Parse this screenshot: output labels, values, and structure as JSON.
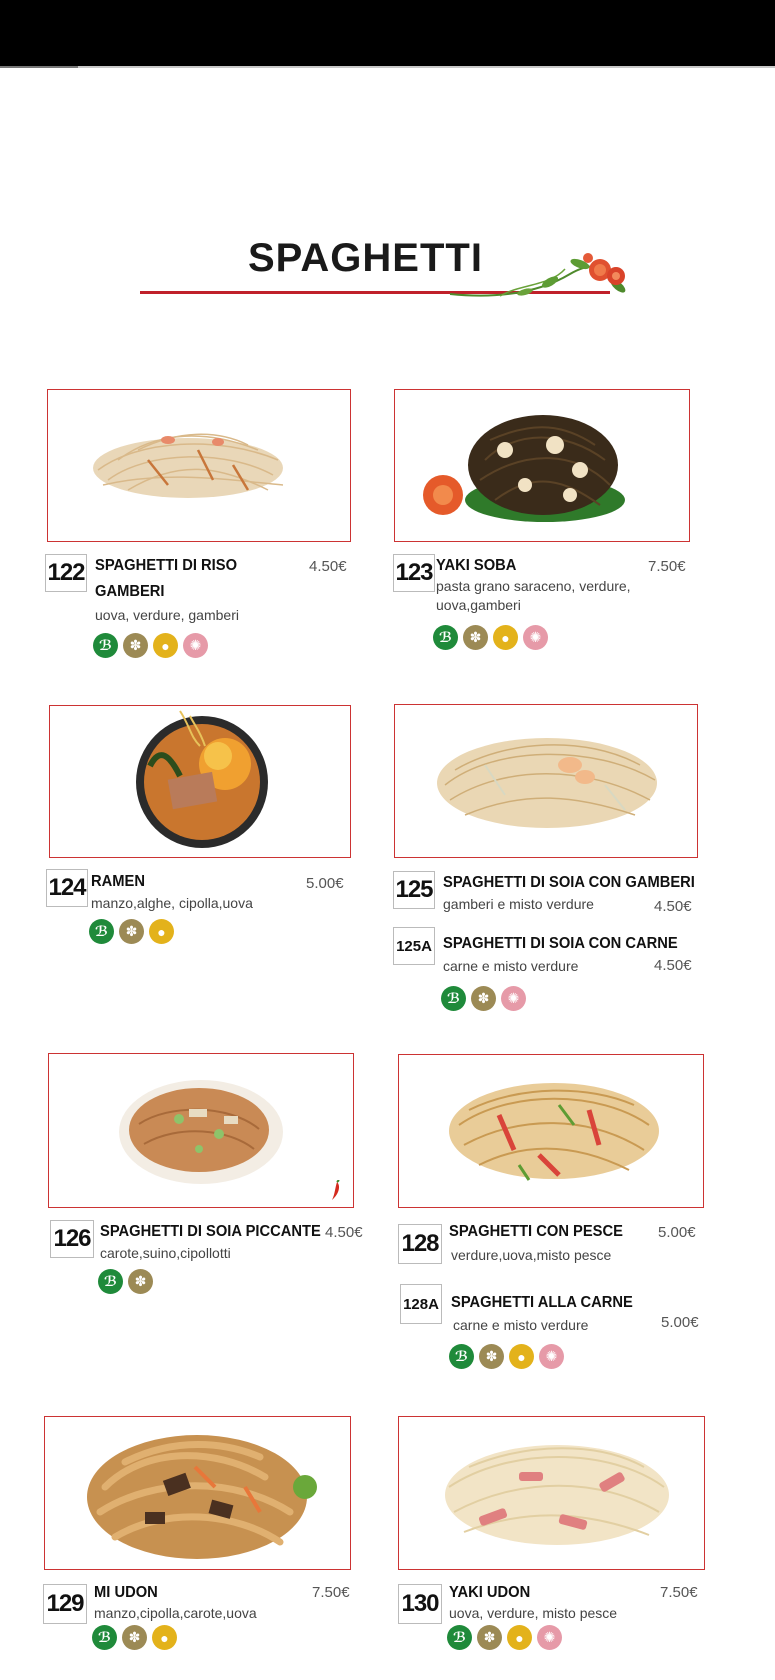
{
  "title": "SPAGHETTI",
  "items": {
    "i122": {
      "num": "122",
      "name_line1": "SPAGHETTI DI RISO",
      "name_line2": "GAMBERI",
      "desc": "uova, verdure, gamberi",
      "price": "4.50€"
    },
    "i123": {
      "num": "123",
      "name_line1": "YAKI SOBA",
      "desc_line1": "pasta grano saraceno, verdure,",
      "desc_line2": "uova,gamberi",
      "price": "7.50€"
    },
    "i124": {
      "num": "124",
      "name_line1": "RAMEN",
      "desc": "manzo,alghe, cipolla,uova",
      "price": "5.00€"
    },
    "i125": {
      "num": "125",
      "name_line1": "SPAGHETTI DI SOIA CON GAMBERI",
      "desc": "gamberi e misto verdure",
      "price": "4.50€"
    },
    "i125a": {
      "num": "125A",
      "name_line1": "SPAGHETTI DI SOIA CON CARNE",
      "desc": "carne e misto verdure",
      "price": "4.50€"
    },
    "i126": {
      "num": "126",
      "name_line1": "SPAGHETTI DI SOIA PICCANTE",
      "desc": "carote,suino,cipollotti",
      "price": "4.50€"
    },
    "i128": {
      "num": "128",
      "name_line1": "SPAGHETTI CON PESCE",
      "desc": "verdure,uova,misto pesce",
      "price": "5.00€"
    },
    "i128a": {
      "num": "128A",
      "name_line1": "SPAGHETTI ALLA CARNE",
      "desc": "carne e misto verdure",
      "price": "5.00€"
    },
    "i129": {
      "num": "129",
      "name_line1": "MI UDON",
      "desc": "manzo,cipolla,carote,uova",
      "price": "7.50€"
    },
    "i130": {
      "num": "130",
      "name_line1": "YAKI UDON",
      "desc": "uova, verdure, misto pesce",
      "price": "7.50€"
    }
  },
  "allergen_icons": [
    "gluten-free-icon",
    "wheat-icon",
    "egg-icon",
    "crab-icon"
  ],
  "colors": {
    "frame": "#cc3333",
    "title_rule": "#c0202a",
    "veg": "#1f8a3a",
    "wheat": "#9c8a55",
    "egg": "#e3b21b",
    "crab": "#e69aa8"
  }
}
